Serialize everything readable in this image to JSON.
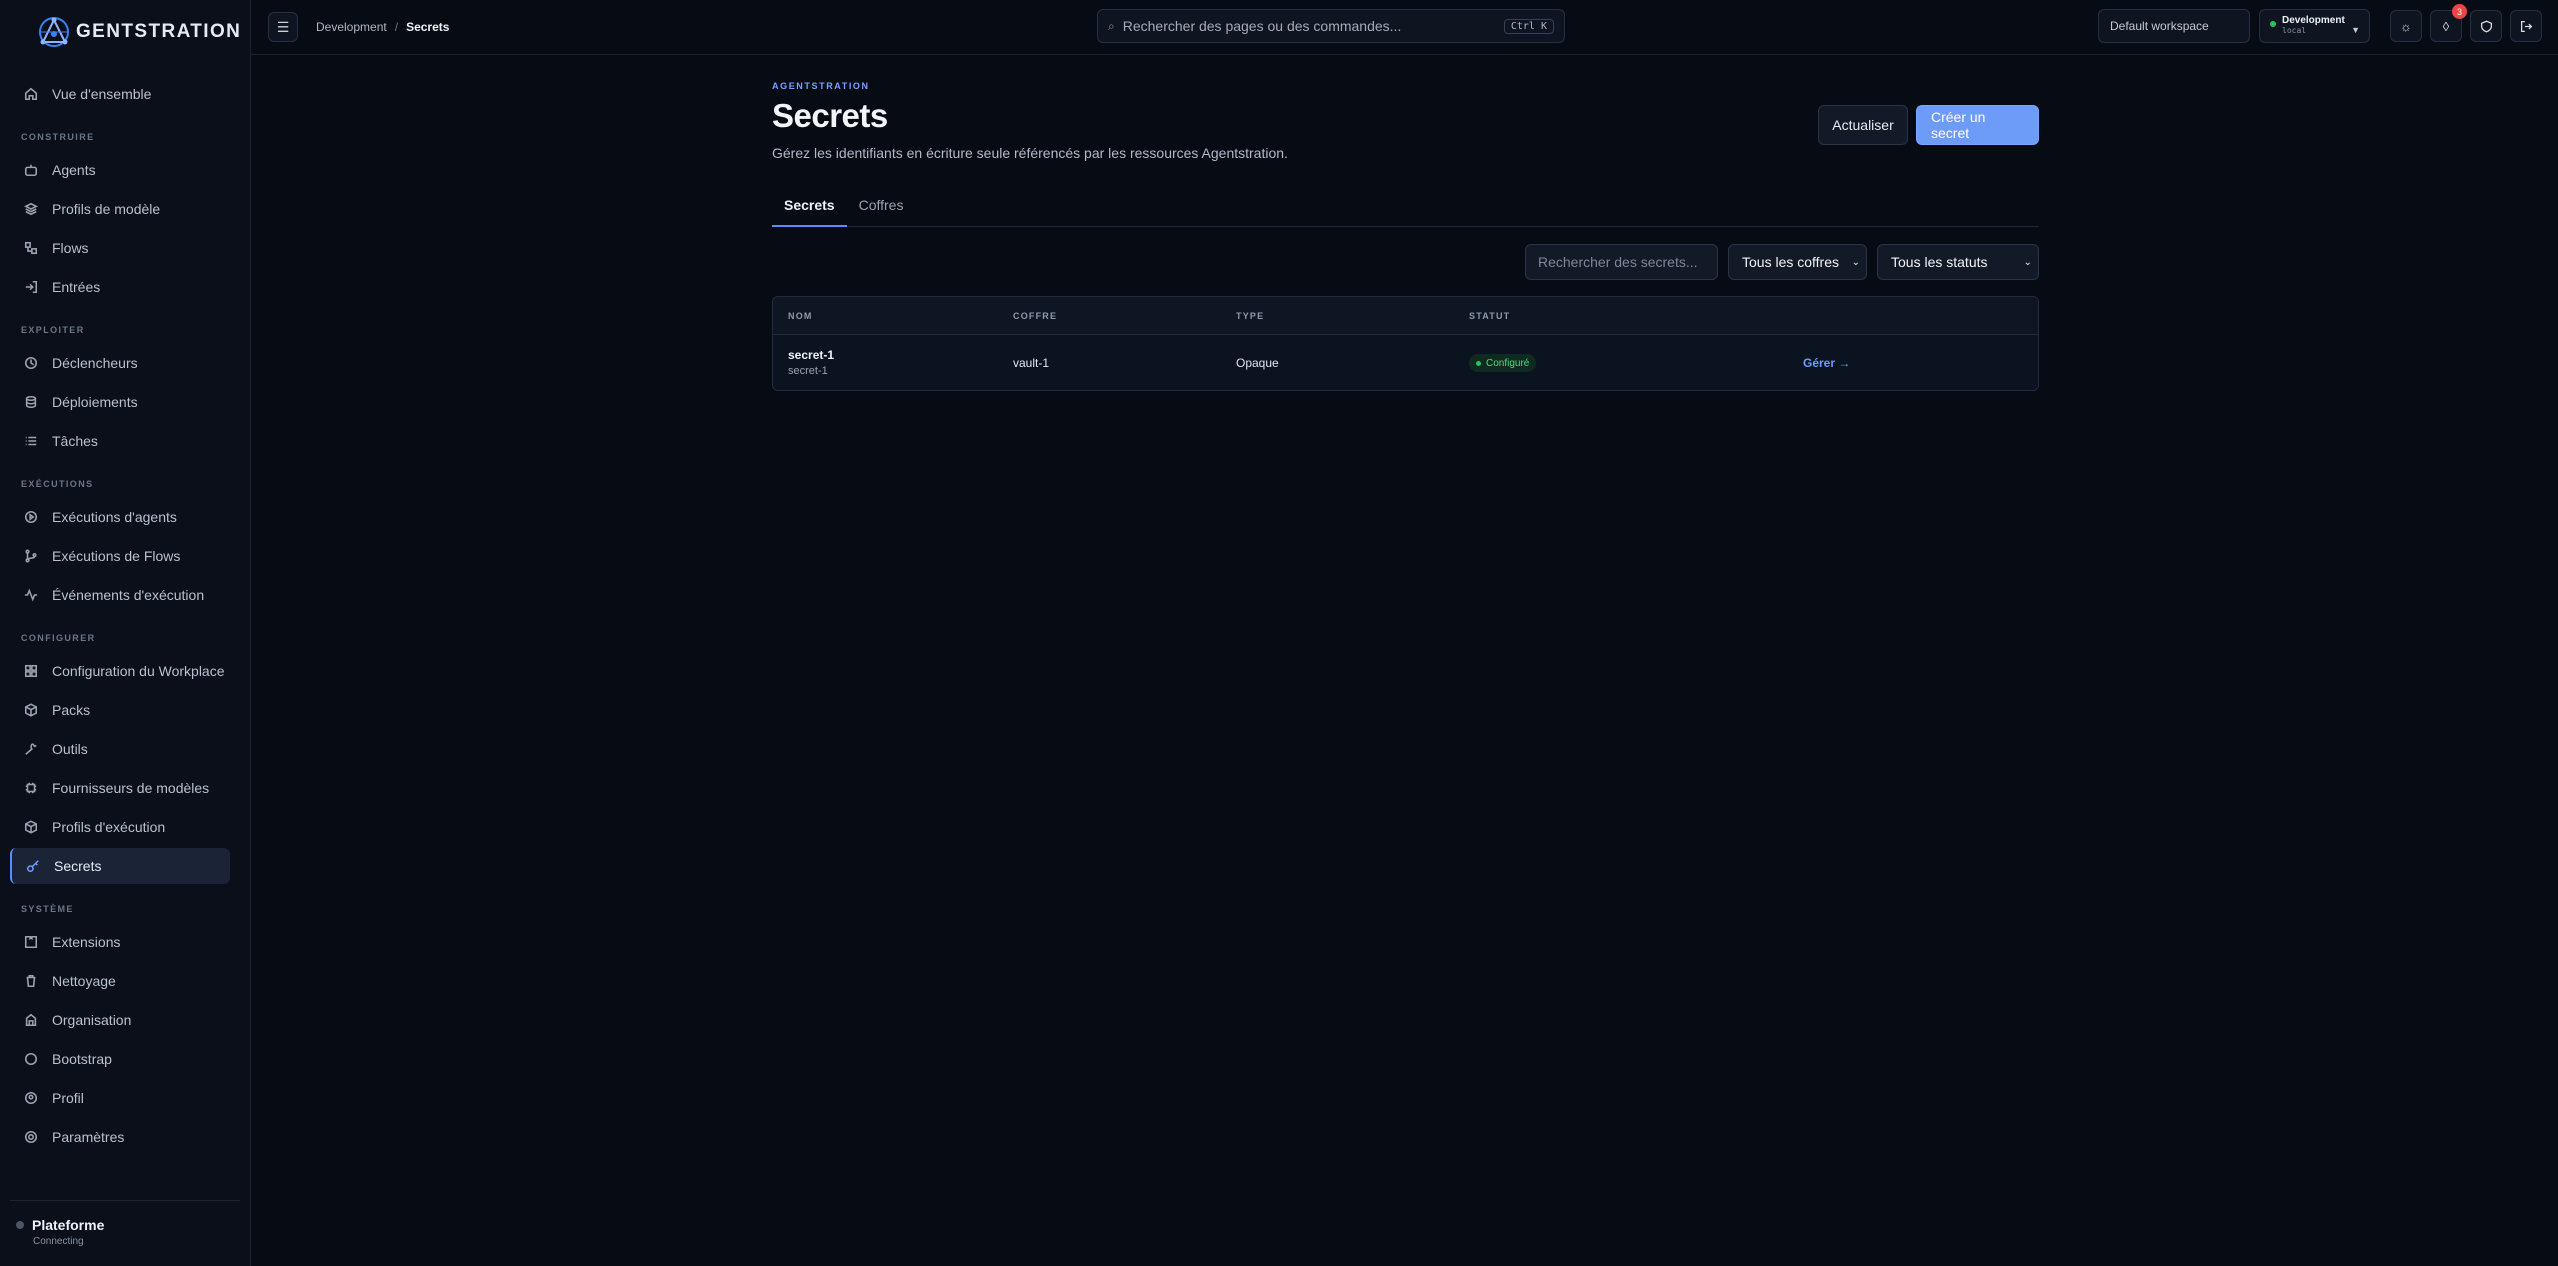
{
  "brand": {
    "name": "GENTSTRATION"
  },
  "sidebar": {
    "overview": "Vue d'ensemble",
    "sections": {
      "build": "CONSTRUIRE",
      "operate": "EXPLOITER",
      "executions": "EXÉCUTIONS",
      "configure": "CONFIGURER",
      "system": "SYSTÈME"
    },
    "build_items": [
      "Agents",
      "Profils de modèle",
      "Flows",
      "Entrées"
    ],
    "operate_items": [
      "Déclencheurs",
      "Déploiements",
      "Tâches"
    ],
    "executions_items": [
      "Exécutions d'agents",
      "Exécutions de Flows",
      "Événements d'exécution"
    ],
    "configure_items": [
      "Configuration du Workplace",
      "Packs",
      "Outils",
      "Fournisseurs de modèles",
      "Profils d'exécution",
      "Secrets"
    ],
    "system_items": [
      "Extensions",
      "Nettoyage",
      "Organisation",
      "Bootstrap",
      "Profil",
      "Paramètres"
    ],
    "active": "Secrets",
    "footer": {
      "title": "Plateforme",
      "status": "Connecting"
    }
  },
  "topbar": {
    "breadcrumb": {
      "parent": "Development",
      "separator": "/",
      "current": "Secrets"
    },
    "search": {
      "placeholder": "Rechercher des pages ou des commandes...",
      "shortcut": "Ctrl K"
    },
    "workspace": "Default workspace",
    "environment": {
      "name": "Development",
      "sub": "local",
      "status_color": "#22c55e"
    },
    "notification_count": "3"
  },
  "page": {
    "eyebrow": "AGENTSTRATION",
    "title": "Secrets",
    "description": "Gérez les identifiants en écriture seule référencés par les ressources Agentstration.",
    "refresh_label": "Actualiser",
    "create_label": "Créer un secret",
    "tabs": [
      "Secrets",
      "Coffres"
    ],
    "active_tab": "Secrets",
    "filters": {
      "search_placeholder": "Rechercher des secrets...",
      "vault_select": "Tous les coffres",
      "status_select": "Tous les statuts"
    },
    "table": {
      "columns": [
        "NOM",
        "COFFRE",
        "TYPE",
        "STATUT"
      ],
      "rows": [
        {
          "name": "secret-1",
          "sub": "secret-1",
          "vault": "vault-1",
          "type": "Opaque",
          "status": "Configuré",
          "action": "Gérer →"
        }
      ]
    }
  },
  "colors": {
    "accent": "#6c9cf8",
    "success": "#22c55e",
    "danger": "#ef4444",
    "background": "#070b14"
  }
}
